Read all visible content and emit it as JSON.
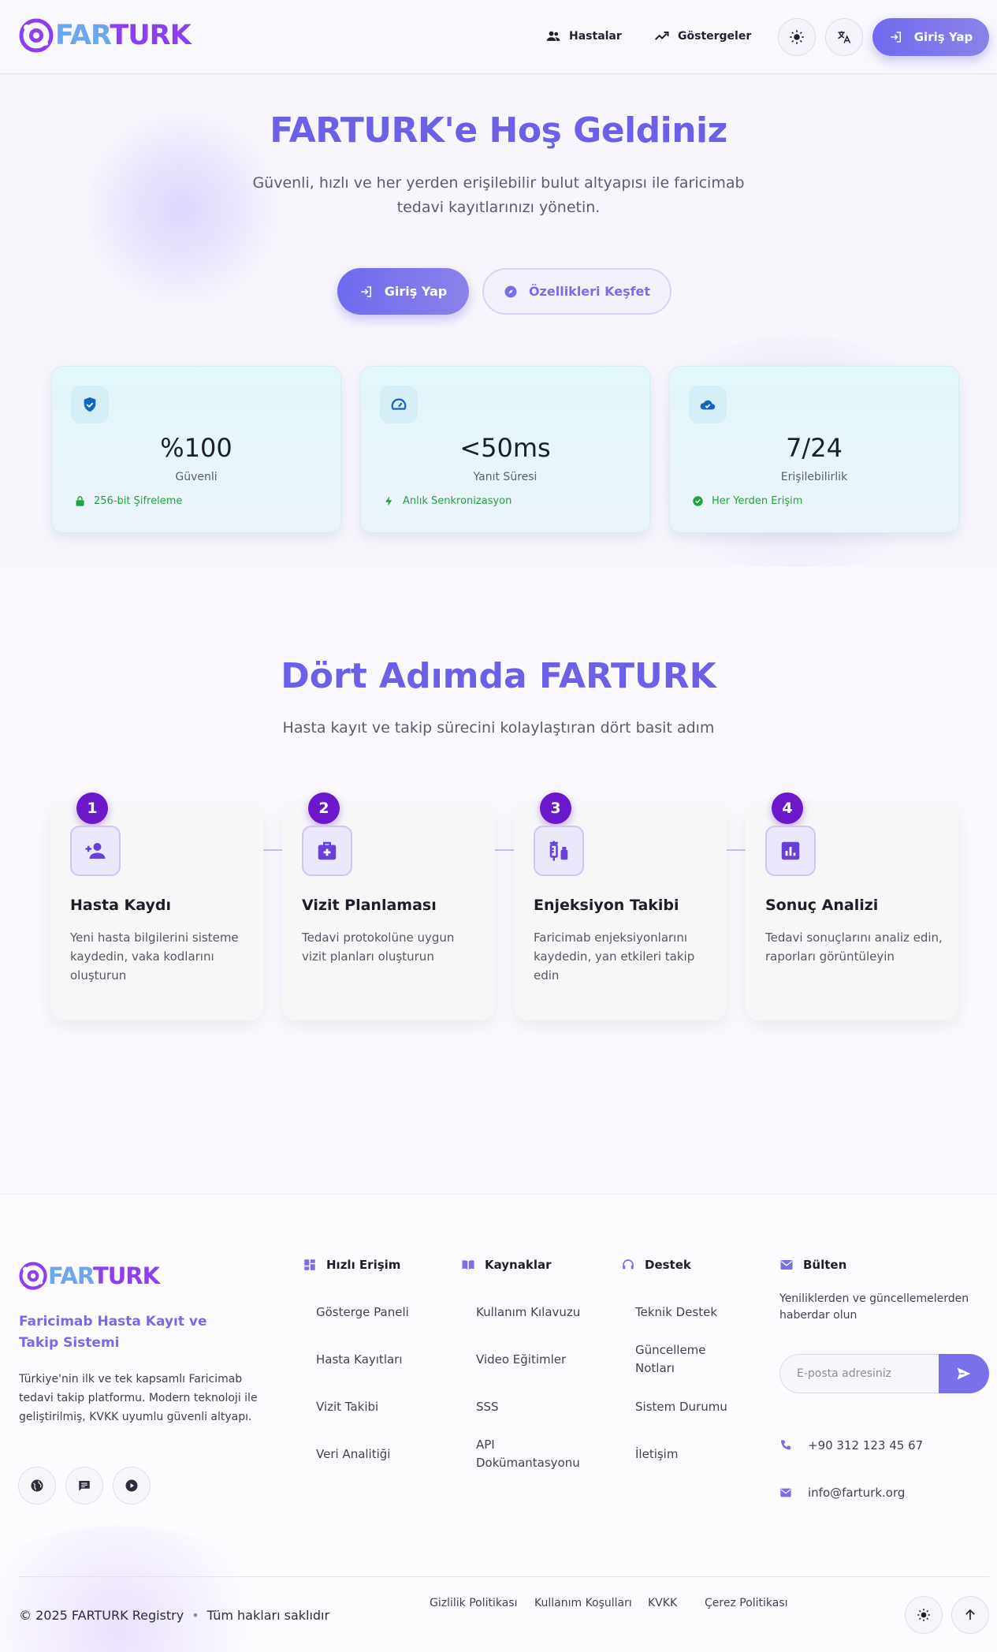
{
  "brand": {
    "far": "FAR",
    "turk": "TURK"
  },
  "header": {
    "nav": [
      {
        "label": "Hastalar",
        "icon": "people-icon"
      },
      {
        "label": "Göstergeler",
        "icon": "trend-icon"
      }
    ],
    "theme_icon": "sun-icon",
    "language_icon": "translate-icon",
    "login_label": "Giriş Yap"
  },
  "hero": {
    "title": "FARTURK'e Hoş Geldiniz",
    "subtitle": "Güvenli, hızlı ve her yerden erişilebilir bulut altyapısı ile faricimab tedavi kayıtlarınızı yönetin.",
    "primary_button": "Giriş Yap",
    "secondary_button": "Özellikleri Keşfet"
  },
  "stats": [
    {
      "icon": "shield-icon",
      "value": "%100",
      "label": "Güvenli",
      "foot_icon": "lock-icon",
      "foot": "256-bit Şifreleme"
    },
    {
      "icon": "speedometer-icon",
      "value": "<50ms",
      "label": "Yanıt Süresi",
      "foot_icon": "bolt-icon",
      "foot": "Anlık Senkronizasyon"
    },
    {
      "icon": "cloud-check-icon",
      "value": "7/24",
      "label": "Erişilebilirlik",
      "foot_icon": "check-circle-icon",
      "foot": "Her Yerden Erişim"
    }
  ],
  "steps_section": {
    "title": "Dört Adımda FARTURK",
    "subtitle": "Hasta kayıt ve takip sürecini kolaylaştıran dört basit adım",
    "steps": [
      {
        "num": "1",
        "icon": "person-add-icon",
        "title": "Hasta Kaydı",
        "desc": "Yeni hasta bilgilerini sisteme kaydedin, vaka kodlarını oluşturun"
      },
      {
        "num": "2",
        "icon": "medical-bag-icon",
        "title": "Vizit Planlaması",
        "desc": "Tedavi protokolüne uygun vizit planları oluşturun"
      },
      {
        "num": "3",
        "icon": "vaccine-icon",
        "title": "Enjeksiyon Takibi",
        "desc": "Faricimab enjeksiyonlarını kaydedin, yan etkileri takip edin"
      },
      {
        "num": "4",
        "icon": "analytics-icon",
        "title": "Sonuç Analizi",
        "desc": "Tedavi sonuçlarını analiz edin, raporları görüntüleyin"
      }
    ]
  },
  "footer": {
    "tagline": "Faricimab Hasta Kayıt ve Takip Sistemi",
    "description": "Türkiye'nin ilk ve tek kapsamlı Faricimab tedavi takip platformu. Modern teknoloji ile geliştirilmiş, KVKK uyumlu güvenli altyapı.",
    "social_icons": [
      "globe-icon",
      "chat-icon",
      "play-icon"
    ],
    "columns": [
      {
        "title": "Hızlı Erişim",
        "icon": "dashboard-icon",
        "links": [
          "Gösterge Paneli",
          "Hasta Kayıtları",
          "Vizit Takibi",
          "Veri Analitiği"
        ]
      },
      {
        "title": "Kaynaklar",
        "icon": "book-icon",
        "links": [
          "Kullanım Kılavuzu",
          "Video Eğitimler",
          "SSS",
          "API Dokümantasyonu"
        ]
      },
      {
        "title": "Destek",
        "icon": "headset-icon",
        "links": [
          "Teknik Destek",
          "Güncelleme Notları",
          "Sistem Durumu",
          "İletişim"
        ]
      }
    ],
    "newsletter": {
      "title": "Bülten",
      "icon": "mail-icon",
      "note": "Yeniliklerden ve güncellemelerden haberdar olun",
      "placeholder": "E-posta adresiniz",
      "send_icon": "send-icon"
    },
    "phone": "+90 312 123 45 67",
    "email": "info@farturk.org",
    "copyright": "© 2025 FARTURK Registry",
    "rights": "Tüm hakları saklıdır",
    "legal_links": [
      "Gizlilik Politikası",
      "Kullanım Koşulları",
      "KVKK",
      "Çerez Politikası"
    ]
  },
  "colors": {
    "accent": "#6c5fe8",
    "step_badge": "#6a18c9",
    "success": "#22a33f",
    "logo_far": "#6aa7f0",
    "logo_turk": "#8b3ff1"
  }
}
